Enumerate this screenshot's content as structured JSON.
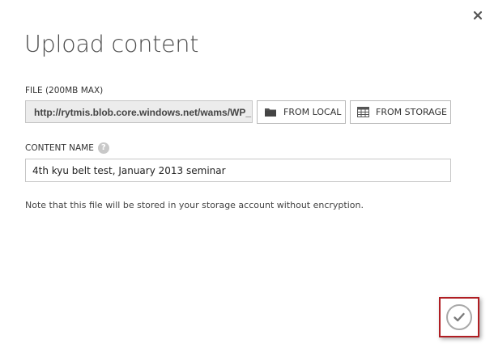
{
  "dialog": {
    "title": "Upload content",
    "close_icon": "close-icon"
  },
  "file": {
    "label": "FILE (200MB MAX)",
    "url_value": "http://rytmis.blob.core.windows.net/wams/WP_",
    "from_local_label": "FROM LOCAL",
    "from_local_icon": "folder-icon",
    "from_storage_label": "FROM STORAGE",
    "from_storage_icon": "storage-grid-icon"
  },
  "content_name": {
    "label": "CONTENT NAME",
    "help_icon": "help-icon",
    "help_glyph": "?",
    "value": "4th kyu belt test, January 2013 seminar"
  },
  "note": "Note that this file will be stored in your storage account without encryption.",
  "confirm": {
    "icon": "checkmark-icon",
    "highlight_color": "#b01e23"
  }
}
